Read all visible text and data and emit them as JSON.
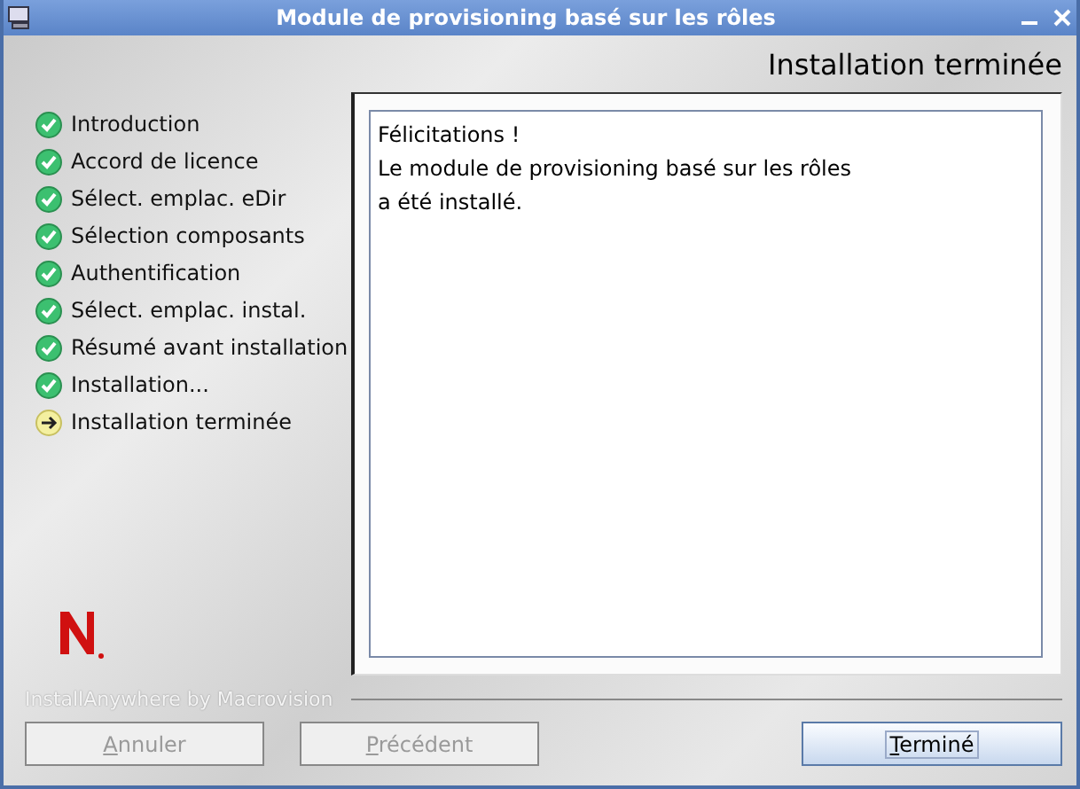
{
  "window": {
    "title": "Module de provisioning basé sur les rôles"
  },
  "header": "Installation terminée",
  "steps": [
    {
      "label": "Introduction",
      "kind": "done"
    },
    {
      "label": "Accord de licence",
      "kind": "done"
    },
    {
      "label": "Sélect. emplac. eDir",
      "kind": "done"
    },
    {
      "label": "Sélection composants",
      "kind": "done"
    },
    {
      "label": "Authentification",
      "kind": "done"
    },
    {
      "label": "Sélect. emplac. instal.",
      "kind": "done"
    },
    {
      "label": "Résumé avant installation",
      "kind": "done"
    },
    {
      "label": "Installation...",
      "kind": "done"
    },
    {
      "label": "Installation terminée",
      "kind": "current"
    }
  ],
  "message": "Félicitations !\nLe module de provisioning basé sur les rôles\na été installé.",
  "brand": "InstallAnywhere by Macrovision",
  "buttons": [
    {
      "label": "Annuler",
      "disabled": true,
      "default": false
    },
    {
      "label": "Précédent",
      "disabled": true,
      "default": false
    },
    {
      "label": "Terminé",
      "disabled": false,
      "default": true
    }
  ]
}
